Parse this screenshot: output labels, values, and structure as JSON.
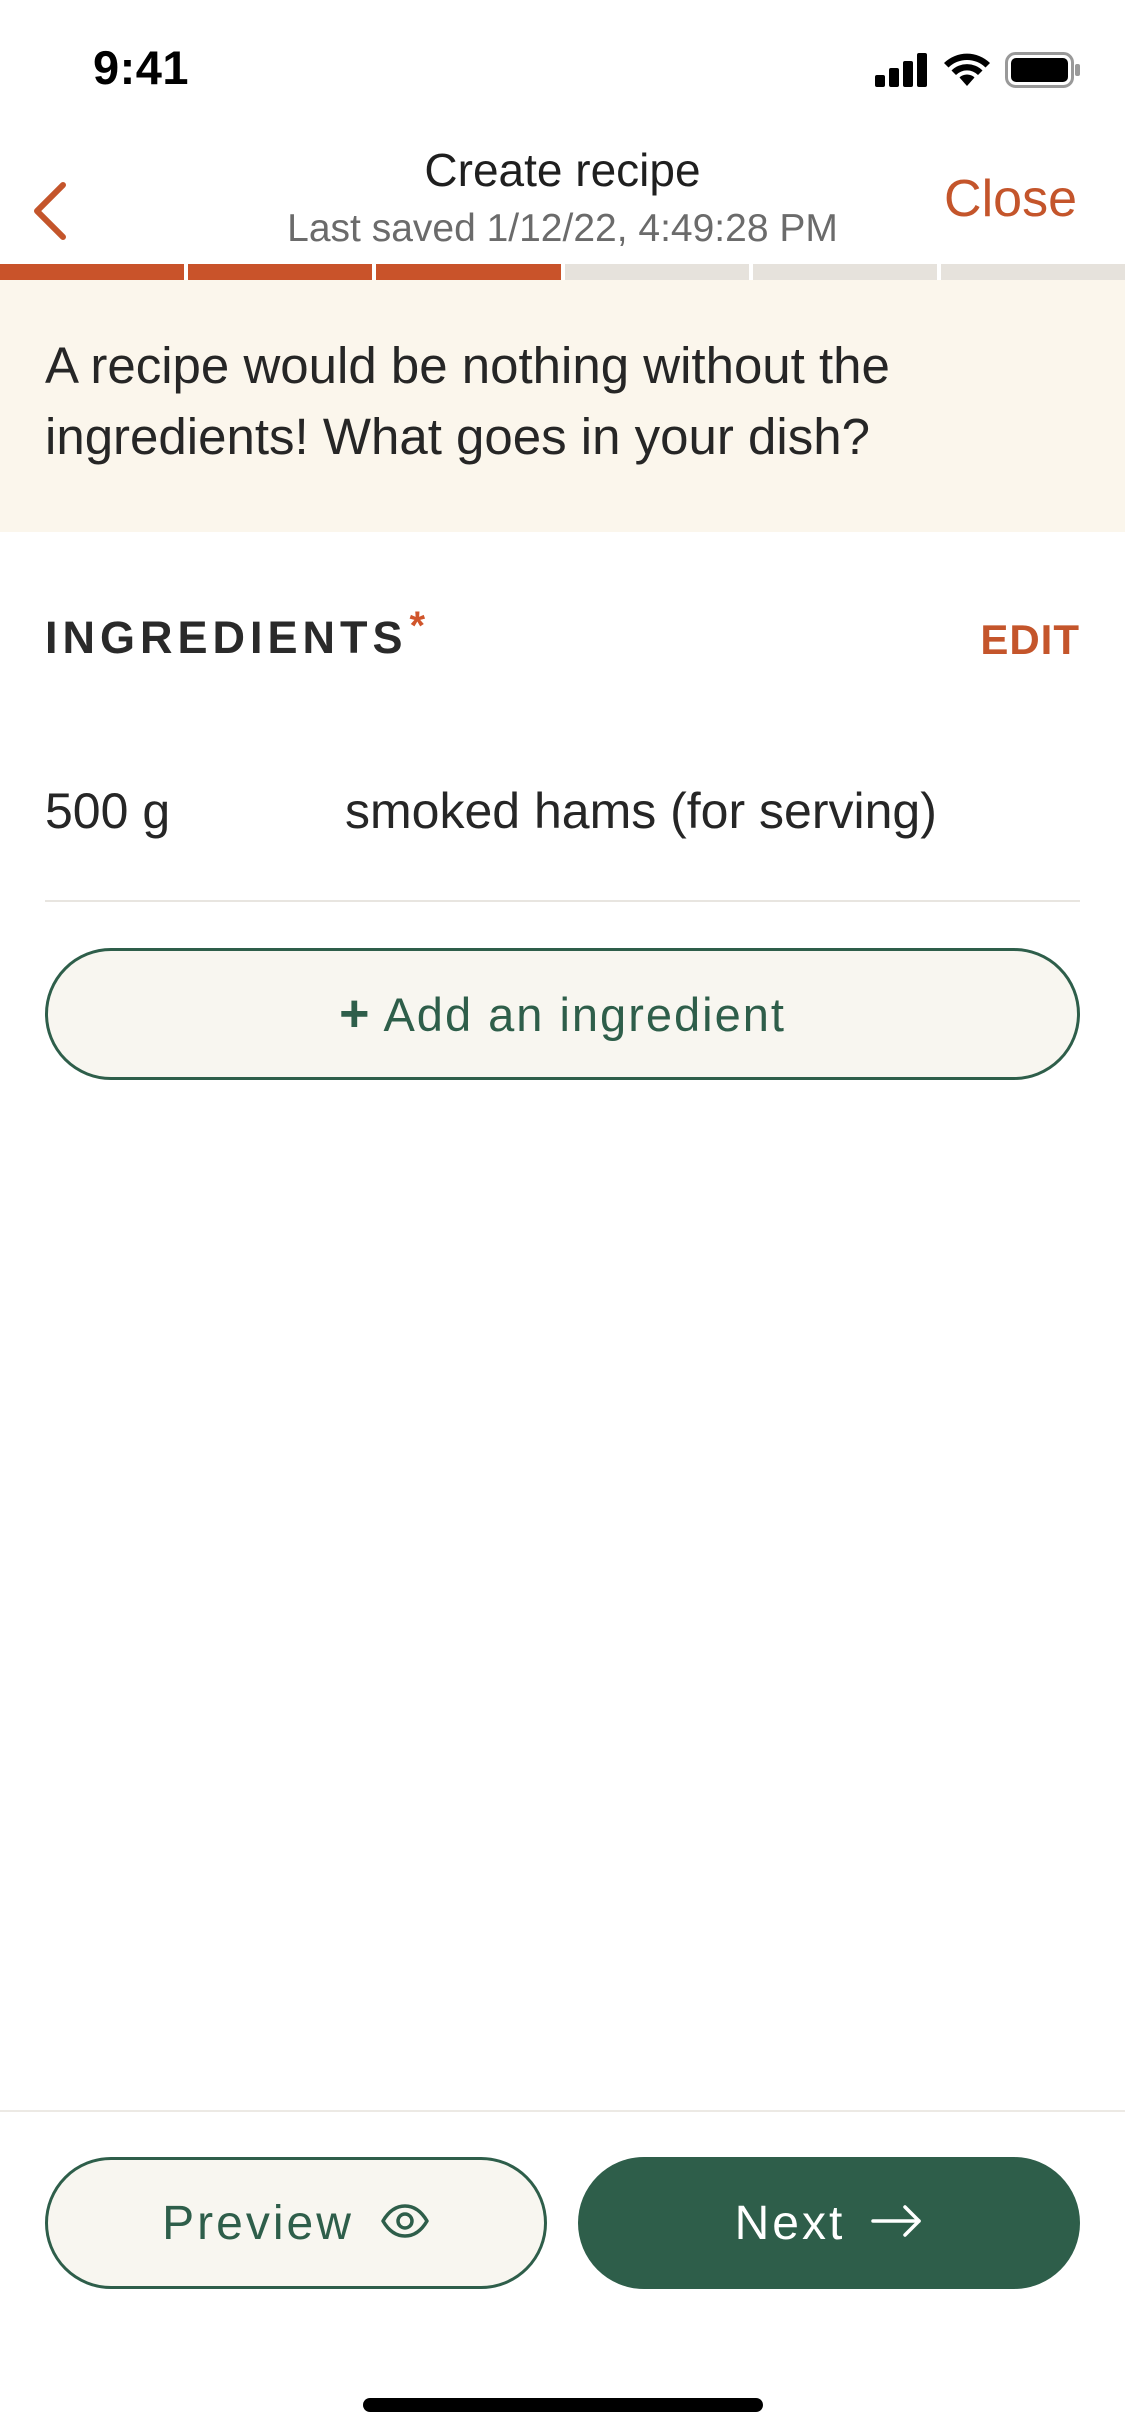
{
  "status_bar": {
    "time": "9:41"
  },
  "nav": {
    "title": "Create recipe",
    "subtitle": "Last saved 1/12/22, 4:49:28 PM",
    "close_label": "Close"
  },
  "progress": {
    "total_steps": 6,
    "completed_steps": 3
  },
  "banner": {
    "text": "A recipe would be nothing without the ingredients! What goes in your dish?"
  },
  "section": {
    "title": "INGREDIENTS",
    "required_mark": "*",
    "edit_label": "EDIT"
  },
  "ingredients": [
    {
      "quantity": "500 g",
      "name": "smoked hams (for serving)"
    }
  ],
  "add_button": {
    "plus": "+",
    "label": "Add an ingredient"
  },
  "footer": {
    "preview_label": "Preview",
    "next_label": "Next"
  },
  "icons": {
    "back": "chevron-left-icon",
    "preview": "eye-icon",
    "next": "arrow-right-icon"
  },
  "colors": {
    "accent": "#c9532a",
    "primary": "#2e5e4a",
    "banner_bg": "#fbf6ec",
    "progress_inactive": "#e6e2dc"
  }
}
